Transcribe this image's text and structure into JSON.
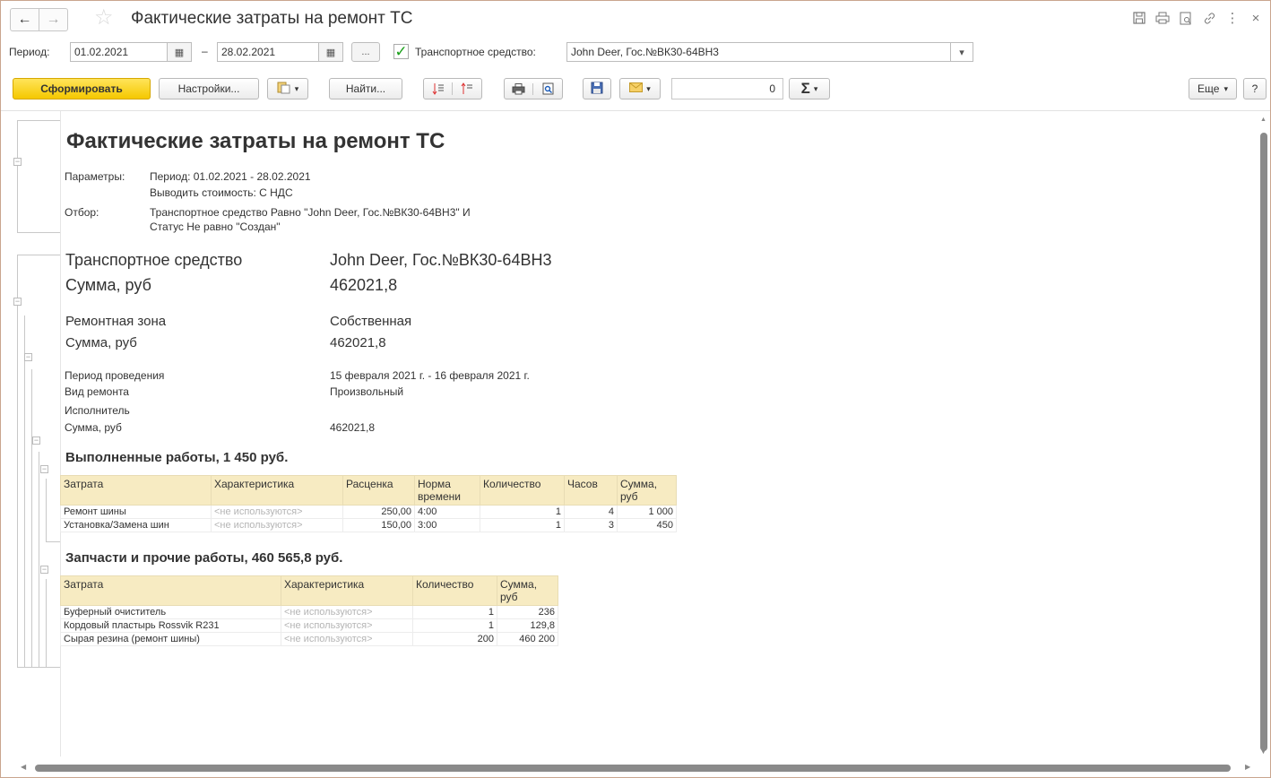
{
  "window": {
    "title": "Фактические затраты на ремонт ТС",
    "back_icon": "←",
    "forward_icon": "→",
    "star_icon": "☆",
    "toolbar_icons": [
      "save-icon",
      "print-icon",
      "preview-icon",
      "link-icon",
      "more-icon",
      "close-icon"
    ],
    "more_glyph": "⋮",
    "close_glyph": "×"
  },
  "period": {
    "label": "Период:",
    "from": "01.02.2021",
    "dash": "–",
    "to": "28.02.2021",
    "calendar_glyph": "▦",
    "more_btn": "...",
    "vehicle_checked": true,
    "check_glyph": "✓",
    "vehicle_label": "Транспортное средство:",
    "vehicle_value": "John Deer, Гос.№ВК30-64ВН3",
    "dropdown_glyph": "▾"
  },
  "toolbar": {
    "generate": "Сформировать",
    "settings": "Настройки...",
    "find": "Найти...",
    "sum_value": "0",
    "sigma": "Σ",
    "more": "Еще",
    "help": "?",
    "caret": "▾"
  },
  "report": {
    "title": "Фактические затраты на ремонт ТС",
    "params_label": "Параметры:",
    "params_line1": "Период: 01.02.2021 - 28.02.2021",
    "params_line2": "Выводить стоимость: С НДС",
    "filter_label": "Отбор:",
    "filter_line1": "Транспортное средство Равно \"John Deer, Гос.№ВК30-64ВН3\" И",
    "filter_line2": "Статус Не равно \"Создан\"",
    "vehicle_label": "Транспортное средство",
    "vehicle_value": "John Deer, Гос.№ВК30-64ВН3",
    "sum_label": "Сумма, руб",
    "vehicle_sum": "462021,8",
    "zone_label": "Ремонтная зона",
    "zone_value": "Собственная",
    "zone_sum_label": "Сумма, руб",
    "zone_sum": "462021,8",
    "period_label": "Период проведения",
    "period_value": "15 февраля 2021 г. - 16 февраля 2021 г.",
    "repair_type_label": "Вид ремонта",
    "repair_type_value": "Произвольный",
    "executor_label": "Исполнитель",
    "detail_sum_label": "Сумма, руб",
    "detail_sum": "462021,8",
    "works_title": "Выполненные работы,   1 450 руб.",
    "works_headers": [
      "Затрата",
      "Характеристика",
      "Расценка",
      "Норма времени",
      "Количество",
      "Часов",
      "Сумма, руб"
    ],
    "works_rows": [
      [
        "Ремонт шины",
        "<не используются>",
        "250,00",
        "4:00",
        "1",
        "4",
        "1 000"
      ],
      [
        "Установка/Замена шин",
        "<не используются>",
        "150,00",
        "3:00",
        "1",
        "3",
        "450"
      ]
    ],
    "parts_title": "Запчасти и прочие работы,   460 565,8 руб.",
    "parts_headers": [
      "Затрата",
      "Характеристика",
      "Количество",
      "Сумма, руб"
    ],
    "parts_rows": [
      [
        "Буферный очиститель",
        "<не используются>",
        "1",
        "236"
      ],
      [
        "Кордовый пластырь Rossvik R231",
        "<не используются>",
        "1",
        "129,8"
      ],
      [
        "Сырая резина (ремонт шины)",
        "<не используются>",
        "200",
        "460 200"
      ]
    ]
  }
}
